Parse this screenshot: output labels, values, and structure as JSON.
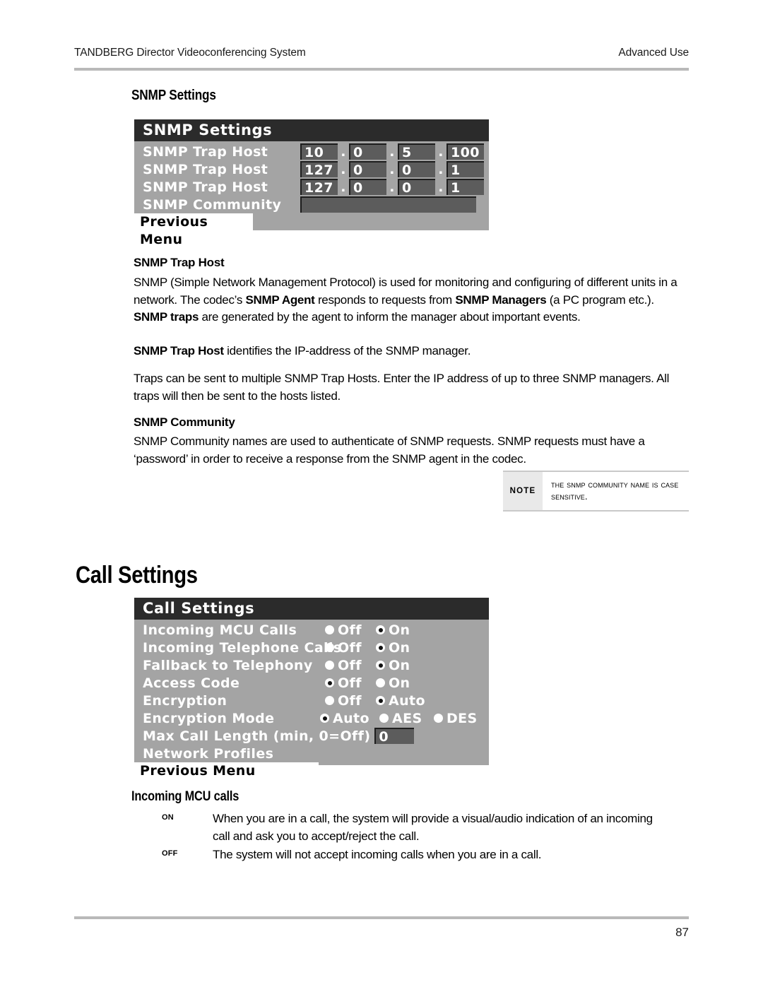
{
  "header": {
    "left": "TANDBERG Director Videoconferencing System",
    "right": "Advanced Use"
  },
  "footer": {
    "page_number": "87"
  },
  "snmp_section": {
    "heading": "SNMP Settings",
    "menu": {
      "title": "SNMP Settings",
      "rows": [
        {
          "label": "SNMP Trap Host",
          "octets": [
            "10",
            "0",
            "5",
            "100"
          ]
        },
        {
          "label": "SNMP Trap Host",
          "octets": [
            "127",
            "0",
            "0",
            "1"
          ]
        },
        {
          "label": "SNMP Trap Host",
          "octets": [
            "127",
            "0",
            "0",
            "1"
          ]
        }
      ],
      "community_label": "SNMP Community",
      "community_value": "",
      "previous_menu": "Previous Menu",
      "dot": "."
    },
    "trap_host_heading": "SNMP Trap Host",
    "trap_host_p1_a": "SNMP (Simple Network Management Protocol) is used for monitoring and configuring of different units in a network. The codec’s ",
    "trap_host_p1_b": "SNMP Agent",
    "trap_host_p1_c": " responds to requests from ",
    "trap_host_p1_d": "SNMP Managers",
    "trap_host_p1_e": " (a PC program etc.). ",
    "trap_host_p1_f": "SNMP traps",
    "trap_host_p1_g": " are generated by the agent to inform the manager about important events.",
    "trap_host_p2_a": "SNMP Trap Host",
    "trap_host_p2_b": " identifies the IP-address of the SNMP manager.",
    "trap_host_p3": "Traps can be sent to multiple SNMP Trap Hosts. Enter the IP address of up to three SNMP managers. All traps will then be sent to the hosts listed.",
    "community_heading": "SNMP Community",
    "community_p1": "SNMP Community names are used to authenticate of SNMP requests. SNMP requests must have a ‘password’ in order to receive a response from the SNMP agent in the codec.",
    "note": {
      "tag": "NOTE",
      "text": "The SNMP Community name is case sensitive."
    }
  },
  "call_section": {
    "heading": "Call Settings",
    "menu": {
      "title": "Call Settings",
      "rows": [
        {
          "label": "Incoming MCU Calls",
          "options": [
            {
              "text": "Off",
              "selected": false
            },
            {
              "text": "On",
              "selected": true
            }
          ]
        },
        {
          "label": "Incoming Telephone Calls",
          "options": [
            {
              "text": "Off",
              "selected": false
            },
            {
              "text": "On",
              "selected": true
            }
          ]
        },
        {
          "label": "Fallback to Telephony",
          "options": [
            {
              "text": "Off",
              "selected": false
            },
            {
              "text": "On",
              "selected": true
            }
          ]
        },
        {
          "label": "Access Code",
          "options": [
            {
              "text": "Off",
              "selected": true
            },
            {
              "text": "On",
              "selected": false
            }
          ]
        },
        {
          "label": "Encryption",
          "options": [
            {
              "text": "Off",
              "selected": false
            },
            {
              "text": "Auto",
              "selected": true
            }
          ]
        },
        {
          "label": "Encryption Mode",
          "options": [
            {
              "text": "Auto",
              "selected": true
            },
            {
              "text": "AES",
              "selected": false
            },
            {
              "text": "DES",
              "selected": false
            }
          ]
        }
      ],
      "max_call_label": "Max Call Length (min, 0=Off)",
      "max_call_value": "0",
      "network_profiles": "Network Profiles",
      "previous_menu": "Previous Menu"
    },
    "mcu_heading": "Incoming MCU calls",
    "definitions": [
      {
        "term": "On",
        "desc": "When you are in a call, the system will provide a visual/audio indication of an incoming call and ask you to accept/reject the call."
      },
      {
        "term": "Off",
        "desc": "The system will not accept incoming calls when you are in a call."
      }
    ]
  }
}
